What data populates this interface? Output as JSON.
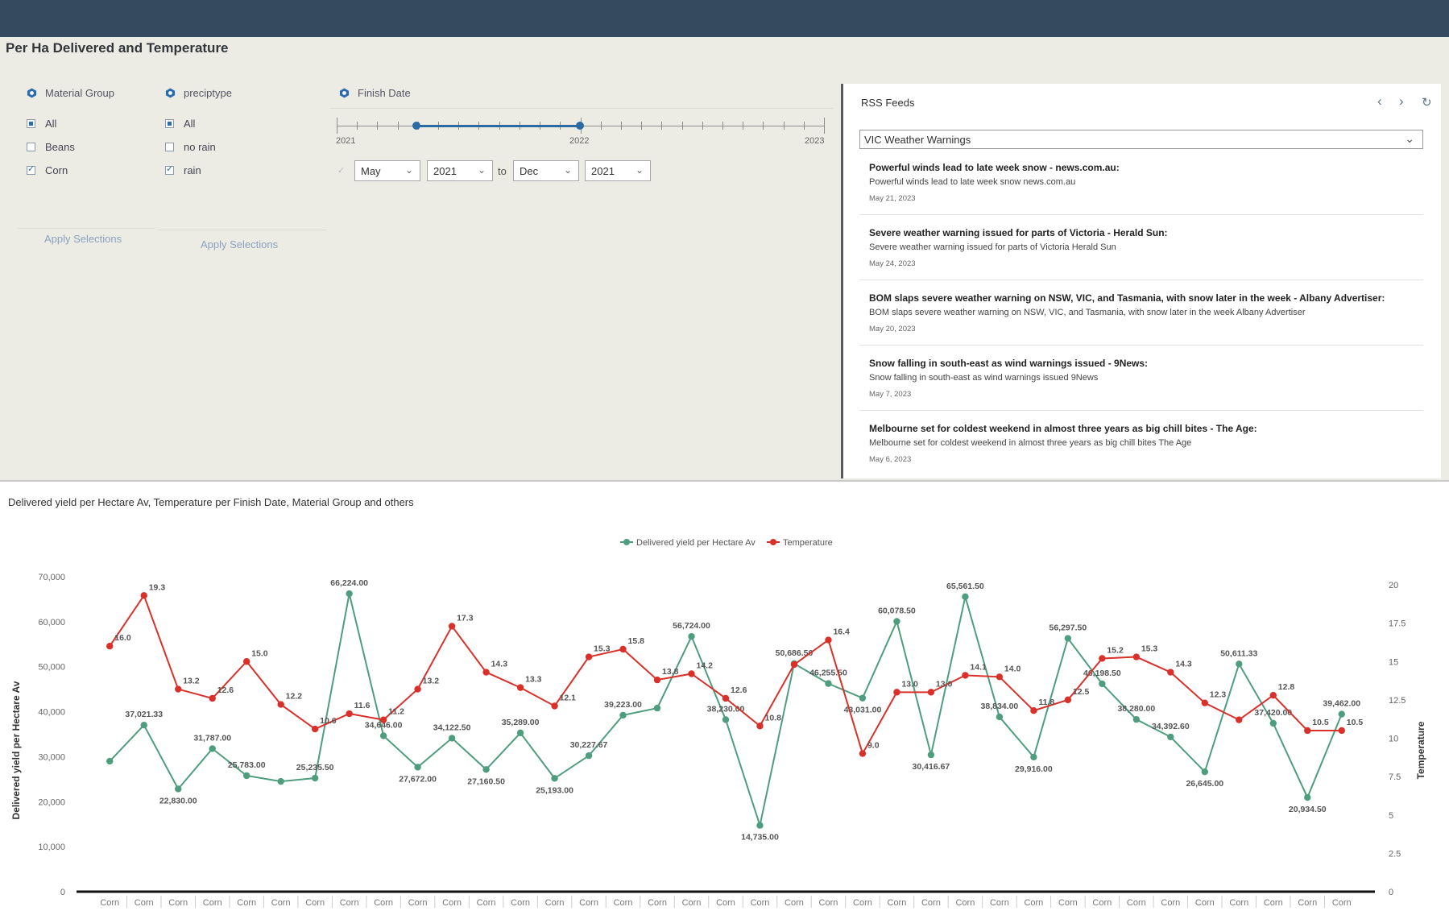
{
  "page_title": "Per Ha Delivered and Temperature",
  "filters": {
    "material_group": {
      "label": "Material Group",
      "options": [
        {
          "label": "All",
          "state": "partial"
        },
        {
          "label": "Beans",
          "state": "unchecked"
        },
        {
          "label": "Corn",
          "state": "checked"
        }
      ],
      "apply_label": "Apply Selections"
    },
    "preciptype": {
      "label": "preciptype",
      "options": [
        {
          "label": "All",
          "state": "partial"
        },
        {
          "label": "no rain",
          "state": "unchecked"
        },
        {
          "label": "rain",
          "state": "checked"
        }
      ],
      "apply_label": "Apply Selections"
    },
    "finish_date": {
      "label": "Finish Date",
      "years": [
        "2021",
        "2022",
        "2023"
      ],
      "range_start": 0.2,
      "range_end": 0.5,
      "from_month": "May",
      "from_year": "2021",
      "to_label": "to",
      "to_month": "Dec",
      "to_year": "2021"
    }
  },
  "rss": {
    "title": "RSS Feeds",
    "feed_selected": "VIC Weather Warnings",
    "items": [
      {
        "title": "Powerful winds lead to late week snow - news.com.au:",
        "desc": "Powerful winds lead to late week snow  news.com.au",
        "date": "May 21, 2023"
      },
      {
        "title": "Severe weather warning issued for parts of Victoria - Herald Sun:",
        "desc": "Severe weather warning issued for parts of Victoria  Herald Sun",
        "date": "May 24, 2023"
      },
      {
        "title": "BOM slaps severe weather warning on NSW, VIC, and Tasmania, with snow later in the week - Albany Advertiser:",
        "desc": "BOM slaps severe weather warning on NSW, VIC, and Tasmania, with snow later in the week  Albany Advertiser",
        "date": "May 20, 2023"
      },
      {
        "title": "Snow falling in south-east as wind warnings issued - 9News:",
        "desc": "Snow falling in south-east as wind warnings issued  9News",
        "date": "May 7, 2023"
      },
      {
        "title": "Melbourne set for coldest weekend in almost three years as big chill bites - The Age:",
        "desc": "Melbourne set for coldest weekend in almost three years as big chill bites  The Age",
        "date": "May 6, 2023"
      }
    ]
  },
  "chart_title": "Delivered yield per Hectare Av, Temperature per Finish Date, Material Group and others",
  "chart_data": {
    "type": "line",
    "title": "",
    "x_category": "Corn",
    "categories_count": 37,
    "ylabel": "Delivered yield per Hectare Av",
    "y2label": "Temperature",
    "ylim": [
      0,
      70000
    ],
    "y2lim": [
      0,
      20
    ],
    "yticks": [
      "0",
      "10,000",
      "20,000",
      "30,000",
      "40,000",
      "50,000",
      "60,000",
      "70,000"
    ],
    "y2ticks": [
      "0",
      "2.5",
      "5",
      "7.5",
      "10",
      "12.5",
      "15",
      "17.5",
      "20"
    ],
    "legend_position": "top-center",
    "series": [
      {
        "name": "Delivered yield per Hectare Av",
        "color": "#4e9e7e",
        "axis": "left",
        "values": [
          29000,
          37021.33,
          22830,
          31787,
          25783,
          24500,
          25235.5,
          66224,
          34646,
          27672,
          34122.5,
          27160.5,
          35289,
          25193,
          30227.67,
          39223,
          40800,
          56724,
          38230,
          14735,
          50686.5,
          46255.5,
          43031,
          60078.5,
          30416.67,
          65561.5,
          38834,
          29916,
          56297.5,
          46198.5,
          38280,
          34392.6,
          26645,
          50611.33,
          37420,
          20934.5,
          39462
        ],
        "labels": [
          "",
          "37,021.33",
          "22,830.00",
          "31,787.00",
          "25,783.00",
          "",
          "25,235.50",
          "66,224.00",
          "34,646.00",
          "27,672.00",
          "34,122.50",
          "27,160.50",
          "35,289.00",
          "25,193.00",
          "30,227.67",
          "39,223.00",
          "",
          "56,724.00",
          "38,230.00",
          "14,735.00",
          "50,686.50",
          "46,255.50",
          "43,031.00",
          "60,078.50",
          "30,416.67",
          "65,561.50",
          "38,834.00",
          "29,916.00",
          "56,297.50",
          "46,198.50",
          "38,280.00",
          "34,392.60",
          "26,645.00",
          "50,611.33",
          "37,420.00",
          "20,934.50",
          "39,462.00"
        ]
      },
      {
        "name": "Temperature",
        "color": "#d9302a",
        "axis": "right",
        "values": [
          16.0,
          19.3,
          13.2,
          12.6,
          15.0,
          12.2,
          10.6,
          11.6,
          11.2,
          13.2,
          17.3,
          14.3,
          13.3,
          12.1,
          15.3,
          15.8,
          13.8,
          14.2,
          12.6,
          10.8,
          14.8,
          16.4,
          9.0,
          13.0,
          13.0,
          14.1,
          14.0,
          11.8,
          12.5,
          15.2,
          15.3,
          14.3,
          12.3,
          11.2,
          12.8,
          10.5,
          10.5
        ],
        "labels": [
          "16.0",
          "19.3",
          "13.2",
          "12.6",
          "15.0",
          "12.2",
          "10.6",
          "11.6",
          "11.2",
          "13.2",
          "17.3",
          "14.3",
          "13.3",
          "12.1",
          "15.3",
          "15.8",
          "13.8",
          "14.2",
          "12.6",
          "10.8",
          "",
          "16.4",
          "9.0",
          "13.0",
          "13.0",
          "14.1",
          "14.0",
          "11.8",
          "12.5",
          "15.2",
          "15.3",
          "14.3",
          "12.3",
          "",
          "12.8",
          "10.5",
          "10.5"
        ]
      }
    ]
  }
}
